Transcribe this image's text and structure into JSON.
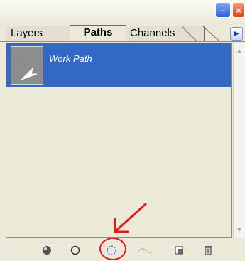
{
  "window": {
    "minimize_glyph": "–",
    "close_glyph": "×"
  },
  "tabs": [
    {
      "label": "Layers"
    },
    {
      "label": "Paths"
    },
    {
      "label": "Channels"
    }
  ],
  "tab_menu_glyph": "▶",
  "paths": [
    {
      "name": "Work Path"
    }
  ],
  "bottom_toolbar": {
    "icons": [
      "fill-path-icon",
      "stroke-path-icon",
      "load-path-as-selection-icon",
      "make-work-path-icon",
      "new-path-icon",
      "delete-path-icon"
    ]
  },
  "annotation": {
    "color": "#e21b1b"
  }
}
